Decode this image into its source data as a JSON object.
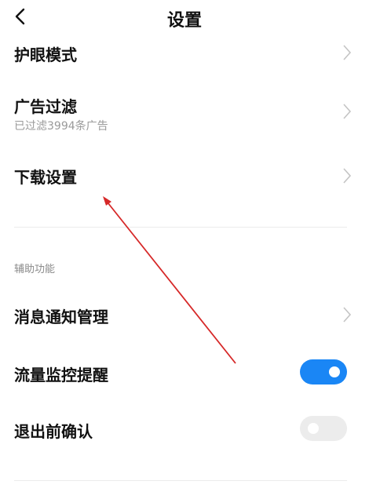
{
  "header": {
    "title": "设置"
  },
  "rows": {
    "eye_mode": {
      "label": "护眼模式"
    },
    "ad_filter": {
      "label": "广告过滤",
      "subtitle": "已过滤3994条广告"
    },
    "download": {
      "label": "下载设置"
    }
  },
  "section": {
    "title": "辅助功能"
  },
  "assist": {
    "notification": {
      "label": "消息通知管理"
    },
    "traffic": {
      "label": "流量监控提醒",
      "enabled": true
    },
    "exit_confirm": {
      "label": "退出前确认",
      "enabled": false
    }
  },
  "colors": {
    "accent": "#1a86f5",
    "annotation_arrow": "#d62828"
  }
}
